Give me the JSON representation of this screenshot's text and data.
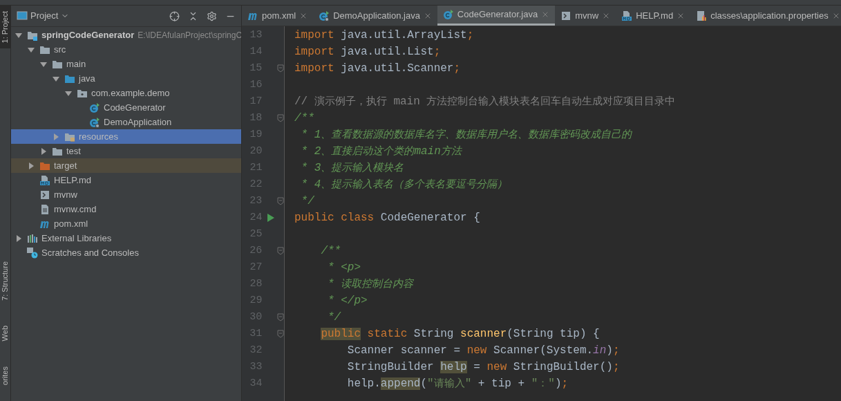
{
  "tool_strip": [
    {
      "label": "1: Project",
      "selected": true
    },
    {
      "label": "7: Structure",
      "selected": false
    },
    {
      "label": "Web",
      "selected": false
    },
    {
      "label": "orites",
      "selected": false
    }
  ],
  "project_panel": {
    "title": "Project",
    "tree": [
      {
        "label": "springCodeGenerator",
        "path": "E:\\IDEAfulanProject\\springC",
        "kind": "project",
        "expanded": true,
        "selected": false,
        "children": [
          {
            "label": "src",
            "kind": "folder",
            "expanded": true,
            "selected": false,
            "children": [
              {
                "label": "main",
                "kind": "folder",
                "expanded": true,
                "selected": false,
                "children": [
                  {
                    "label": "java",
                    "kind": "source-folder",
                    "expanded": true,
                    "selected": false,
                    "children": [
                      {
                        "label": "com.example.demo",
                        "kind": "package",
                        "expanded": true,
                        "selected": false,
                        "children": [
                          {
                            "label": "CodeGenerator",
                            "kind": "class",
                            "selected": false
                          },
                          {
                            "label": "DemoApplication",
                            "kind": "spring-class",
                            "selected": false
                          }
                        ]
                      }
                    ]
                  },
                  {
                    "label": "resources",
                    "kind": "resource-folder",
                    "expanded": false,
                    "selected": true
                  }
                ]
              },
              {
                "label": "test",
                "kind": "folder",
                "expanded": false,
                "selected": false
              }
            ]
          },
          {
            "label": "target",
            "kind": "excluded-folder",
            "expanded": false,
            "selected": false
          },
          {
            "label": "HELP.md",
            "kind": "markdown",
            "selected": false
          },
          {
            "label": "mvnw",
            "kind": "shell",
            "selected": false
          },
          {
            "label": "mvnw.cmd",
            "kind": "text-file",
            "selected": false
          },
          {
            "label": "pom.xml",
            "kind": "maven",
            "selected": false
          }
        ]
      },
      {
        "label": "External Libraries",
        "kind": "libraries",
        "expanded": false,
        "selected": false
      },
      {
        "label": "Scratches and Consoles",
        "kind": "scratches",
        "selected": false
      }
    ]
  },
  "editor_tabs": [
    {
      "label": "pom.xml",
      "kind": "maven",
      "selected": false
    },
    {
      "label": "DemoApplication.java",
      "kind": "spring-class",
      "selected": false
    },
    {
      "label": "CodeGenerator.java",
      "kind": "class",
      "selected": true
    },
    {
      "label": "mvnw",
      "kind": "shell",
      "selected": false
    },
    {
      "label": "HELP.md",
      "kind": "markdown",
      "selected": false
    },
    {
      "label": "classes\\application.properties",
      "kind": "properties",
      "selected": false
    }
  ],
  "code_lines": [
    {
      "number": "13",
      "fold": false,
      "run": false,
      "tokens": [
        {
          "kind": "keyword",
          "text": "import"
        },
        {
          "kind": "plain",
          "text": " java.util.ArrayList"
        },
        {
          "kind": "keyword",
          "text": ";"
        }
      ]
    },
    {
      "number": "14",
      "fold": false,
      "run": false,
      "tokens": [
        {
          "kind": "keyword",
          "text": "import"
        },
        {
          "kind": "plain",
          "text": " java.util.List"
        },
        {
          "kind": "keyword",
          "text": ";"
        }
      ]
    },
    {
      "number": "15",
      "fold": true,
      "run": false,
      "tokens": [
        {
          "kind": "keyword",
          "text": "import"
        },
        {
          "kind": "plain",
          "text": " java.util.Scanner"
        },
        {
          "kind": "keyword",
          "text": ";"
        }
      ]
    },
    {
      "number": "16",
      "fold": false,
      "run": false
    },
    {
      "number": "17",
      "fold": false,
      "run": false,
      "tokens": [
        {
          "kind": "comment",
          "text": "// 演示例子，执行 main 方法控制台输入模块表名回车自动生成对应项目目录中"
        }
      ]
    },
    {
      "number": "18",
      "fold": true,
      "run": false,
      "tokens": [
        {
          "kind": "doc",
          "text": "/**"
        }
      ]
    },
    {
      "number": "19",
      "fold": false,
      "run": false,
      "tokens": [
        {
          "kind": "doc",
          "text": " * 1、查看数据源的数据库名字、数据库用户名、数据库密码改成自己的"
        }
      ]
    },
    {
      "number": "20",
      "fold": false,
      "run": false,
      "tokens": [
        {
          "kind": "doc",
          "text": " * 2、直接启动这个类的main方法"
        }
      ]
    },
    {
      "number": "21",
      "fold": false,
      "run": false,
      "tokens": [
        {
          "kind": "doc",
          "text": " * 3、提示输入模块名"
        }
      ]
    },
    {
      "number": "22",
      "fold": false,
      "run": false,
      "tokens": [
        {
          "kind": "doc",
          "text": " * 4、提示输入表名（多个表名要逗号分隔）"
        }
      ]
    },
    {
      "number": "23",
      "fold": true,
      "run": false,
      "tokens": [
        {
          "kind": "doc",
          "text": " */"
        }
      ]
    },
    {
      "number": "24",
      "fold": false,
      "run": true,
      "tokens": [
        {
          "kind": "keyword",
          "text": "public class"
        },
        {
          "kind": "plain",
          "text": " CodeGenerator {"
        }
      ]
    },
    {
      "number": "25",
      "fold": false,
      "run": false
    },
    {
      "number": "26",
      "fold": true,
      "run": false,
      "tokens": [
        {
          "kind": "doc",
          "text": "    /**"
        }
      ]
    },
    {
      "number": "27",
      "fold": false,
      "run": false,
      "tokens": [
        {
          "kind": "doc",
          "text": "     * <p>"
        }
      ]
    },
    {
      "number": "28",
      "fold": false,
      "run": false,
      "tokens": [
        {
          "kind": "doc",
          "text": "     * 读取控制台内容"
        }
      ]
    },
    {
      "number": "29",
      "fold": false,
      "run": false,
      "tokens": [
        {
          "kind": "doc",
          "text": "     * </p>"
        }
      ]
    },
    {
      "number": "30",
      "fold": true,
      "run": false,
      "tokens": [
        {
          "kind": "doc",
          "text": "     */"
        }
      ]
    },
    {
      "number": "31",
      "fold": true,
      "run": false,
      "tokens": [
        {
          "kind": "keyword-marked",
          "text": "    public"
        },
        {
          "kind": "keyword",
          "text": " static"
        },
        {
          "kind": "plain",
          "text": " String "
        },
        {
          "kind": "method",
          "text": "scanner"
        },
        {
          "kind": "plain",
          "text": "(String tip) {"
        }
      ]
    },
    {
      "number": "32",
      "fold": false,
      "run": false,
      "tokens": [
        {
          "kind": "plain",
          "text": "        Scanner scanner = "
        },
        {
          "kind": "keyword",
          "text": "new"
        },
        {
          "kind": "plain",
          "text": " Scanner(System."
        },
        {
          "kind": "field",
          "text": "in"
        },
        {
          "kind": "plain",
          "text": ")"
        },
        {
          "kind": "keyword",
          "text": ";"
        }
      ]
    },
    {
      "number": "33",
      "fold": false,
      "run": false,
      "tokens": [
        {
          "kind": "plain",
          "text": "        StringBuilder "
        },
        {
          "kind": "plain-marked",
          "text": "help"
        },
        {
          "kind": "plain",
          "text": " = "
        },
        {
          "kind": "keyword",
          "text": "new"
        },
        {
          "kind": "plain",
          "text": " StringBuilder()"
        },
        {
          "kind": "keyword",
          "text": ";"
        }
      ]
    },
    {
      "number": "34",
      "fold": false,
      "run": false,
      "tokens": [
        {
          "kind": "plain",
          "text": "        help."
        },
        {
          "kind": "plain-marked",
          "text": "append"
        },
        {
          "kind": "plain",
          "text": "("
        },
        {
          "kind": "string",
          "text": "\"请输入\""
        },
        {
          "kind": "plain",
          "text": " + tip + "
        },
        {
          "kind": "string",
          "text": "\"：\""
        },
        {
          "kind": "plain",
          "text": ")"
        },
        {
          "kind": "keyword",
          "text": ";"
        }
      ]
    }
  ]
}
